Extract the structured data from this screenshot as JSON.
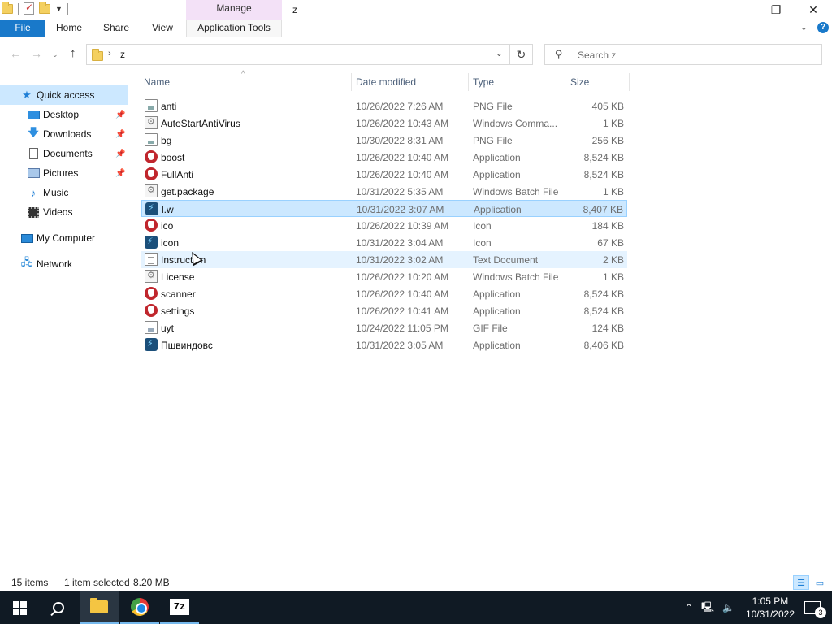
{
  "titlebar": {
    "manage_label": "Manage",
    "window_title": "z",
    "minimize": "—",
    "restore": "❐",
    "close": "✕"
  },
  "ribbon": {
    "tabs": [
      "File",
      "Home",
      "Share",
      "View",
      "Application Tools"
    ],
    "expand": "⌄",
    "help": "?"
  },
  "nav": {
    "back": "←",
    "forward": "→",
    "up": "↑",
    "path_separator": "›",
    "path": "z",
    "dropdown": "⌄",
    "refresh": "↻",
    "search_placeholder": "Search z",
    "search_icon": "⚲"
  },
  "sidebar": {
    "items": [
      {
        "label": "Quick access",
        "icon": "star-icon"
      },
      {
        "label": "Desktop",
        "icon": "desktop-icon",
        "pinned": true
      },
      {
        "label": "Downloads",
        "icon": "download-icon",
        "pinned": true
      },
      {
        "label": "Documents",
        "icon": "documents-icon",
        "pinned": true
      },
      {
        "label": "Pictures",
        "icon": "pictures-icon",
        "pinned": true
      },
      {
        "label": "Music",
        "icon": "music-icon"
      },
      {
        "label": "Videos",
        "icon": "videos-icon"
      },
      {
        "label": "My Computer",
        "icon": "computer-icon"
      },
      {
        "label": "Network",
        "icon": "network-icon"
      }
    ]
  },
  "columns": [
    "Name",
    "Date modified",
    "Type",
    "Size"
  ],
  "files": [
    {
      "name": "anti",
      "date": "10/26/2022 7:26 AM",
      "type": "PNG File",
      "size": "405 KB",
      "icon": "png"
    },
    {
      "name": "AutoStartAntiVirus",
      "date": "10/26/2022 10:43 AM",
      "type": "Windows Comma...",
      "size": "1 KB",
      "icon": "bat"
    },
    {
      "name": "bg",
      "date": "10/30/2022 8:31 AM",
      "type": "PNG File",
      "size": "256 KB",
      "icon": "png"
    },
    {
      "name": "boost",
      "date": "10/26/2022 10:40 AM",
      "type": "Application",
      "size": "8,524 KB",
      "icon": "app"
    },
    {
      "name": "FullAnti",
      "date": "10/26/2022 10:40 AM",
      "type": "Application",
      "size": "8,524 KB",
      "icon": "app"
    },
    {
      "name": "get.package",
      "date": "10/31/2022 5:35 AM",
      "type": "Windows Batch File",
      "size": "1 KB",
      "icon": "bat"
    },
    {
      "name": "l.w",
      "date": "10/31/2022 3:07 AM",
      "type": "Application",
      "size": "8,407 KB",
      "icon": "app2"
    },
    {
      "name": "ico",
      "date": "10/26/2022 10:39 AM",
      "type": "Icon",
      "size": "184 KB",
      "icon": "ico"
    },
    {
      "name": "icon",
      "date": "10/31/2022 3:04 AM",
      "type": "Icon",
      "size": "67 KB",
      "icon": "app2"
    },
    {
      "name": "Instruction",
      "date": "10/31/2022 3:02 AM",
      "type": "Text Document",
      "size": "2 KB",
      "icon": "txt"
    },
    {
      "name": "License",
      "date": "10/26/2022 10:20 AM",
      "type": "Windows Batch File",
      "size": "1 KB",
      "icon": "bat"
    },
    {
      "name": "scanner",
      "date": "10/26/2022 10:40 AM",
      "type": "Application",
      "size": "8,524 KB",
      "icon": "app"
    },
    {
      "name": "settings",
      "date": "10/26/2022 10:41 AM",
      "type": "Application",
      "size": "8,524 KB",
      "icon": "app"
    },
    {
      "name": "uyt",
      "date": "10/24/2022 11:05 PM",
      "type": "GIF File",
      "size": "124 KB",
      "icon": "gif"
    },
    {
      "name": "Пшвиндовс",
      "date": "10/31/2022 3:05 AM",
      "type": "Application",
      "size": "8,406 KB",
      "icon": "app2"
    }
  ],
  "selected_index": 6,
  "hover_index": 9,
  "status": {
    "items": "15 items",
    "selected": "1 item selected",
    "size": "8.20 MB"
  },
  "taskbar": {
    "time": "1:05 PM",
    "date": "10/31/2022",
    "notifications": "3",
    "tray_chevron": "⌃",
    "apps": [
      "Start",
      "Search",
      "File Explorer",
      "Google Chrome",
      "7-Zip"
    ],
    "zip_label": "7z"
  },
  "colors": {
    "accent": "#1979ca",
    "selection": "#cce8ff",
    "taskbar": "#101a24"
  }
}
